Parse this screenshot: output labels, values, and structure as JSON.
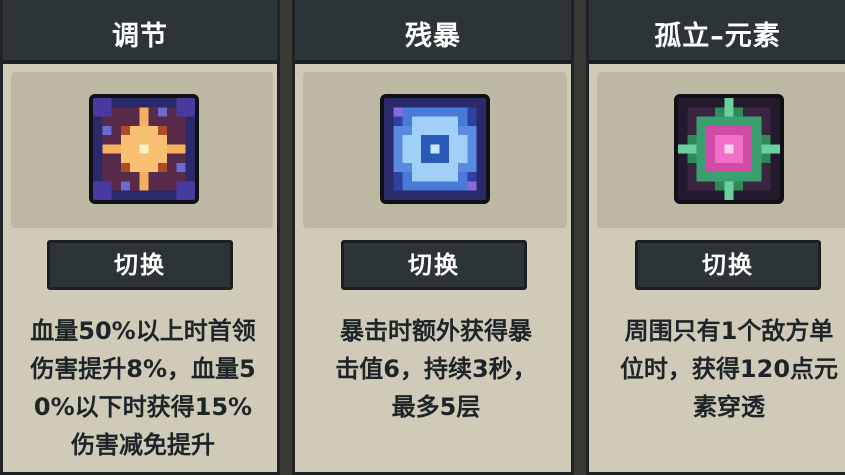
{
  "cards": [
    {
      "title": "调节",
      "icon": "adjust-star-icon",
      "button_label": "切换",
      "description": [
        "血量50%以上时首领",
        "伤害提升8%，血量5",
        "0%以下时获得15%",
        "伤害减免提升"
      ]
    },
    {
      "title": "残暴",
      "icon": "brutal-crystal-icon",
      "button_label": "切换",
      "description": [
        "暴击时额外获得暴",
        "击值6，持续3秒，",
        "最多5层"
      ]
    },
    {
      "title": "孤立–元素",
      "icon": "isolate-element-gem-icon",
      "button_label": "切换",
      "description": [
        "周围只有1个敌方单",
        "位时，获得120点元",
        "素穿透"
      ]
    }
  ],
  "colors": {
    "card_bg": "#cfcbb8",
    "header_bg": "#2c3438",
    "text_dark": "#1e2428",
    "text_light": "#ffffff"
  }
}
